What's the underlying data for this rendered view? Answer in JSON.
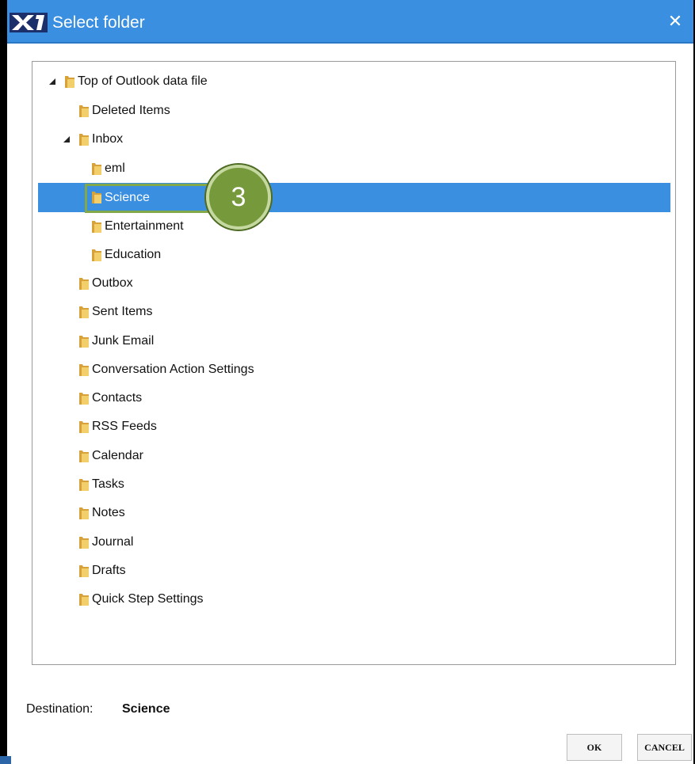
{
  "window": {
    "title": "Select folder",
    "app_icon": "x1-logo-icon",
    "close_symbol": "✕",
    "titlebar_color": "#3a8fe1"
  },
  "tree": {
    "root": {
      "label": "Top of Outlook data file",
      "expanded": true
    },
    "items": [
      {
        "label": "Deleted Items",
        "level": 1
      },
      {
        "label": "Inbox",
        "level": 1,
        "expanded": true
      },
      {
        "label": "eml",
        "level": 2
      },
      {
        "label": "Science",
        "level": 2,
        "selected": true
      },
      {
        "label": "Entertainment",
        "level": 2
      },
      {
        "label": "Education",
        "level": 2
      },
      {
        "label": "Outbox",
        "level": 1
      },
      {
        "label": "Sent Items",
        "level": 1
      },
      {
        "label": "Junk Email",
        "level": 1
      },
      {
        "label": "Conversation Action Settings",
        "level": 1
      },
      {
        "label": "Contacts",
        "level": 1
      },
      {
        "label": "RSS Feeds",
        "level": 1
      },
      {
        "label": "Calendar",
        "level": 1
      },
      {
        "label": "Tasks",
        "level": 1
      },
      {
        "label": "Notes",
        "level": 1
      },
      {
        "label": "Journal",
        "level": 1
      },
      {
        "label": "Drafts",
        "level": 1
      },
      {
        "label": "Quick Step Settings",
        "level": 1
      }
    ],
    "selection_color": "#3a8fe1"
  },
  "annotation": {
    "step_number": "3",
    "color": "#769a3b"
  },
  "destination": {
    "label": "Destination:",
    "value": "Science"
  },
  "buttons": {
    "ok": "OK",
    "cancel": "CANCEL"
  }
}
